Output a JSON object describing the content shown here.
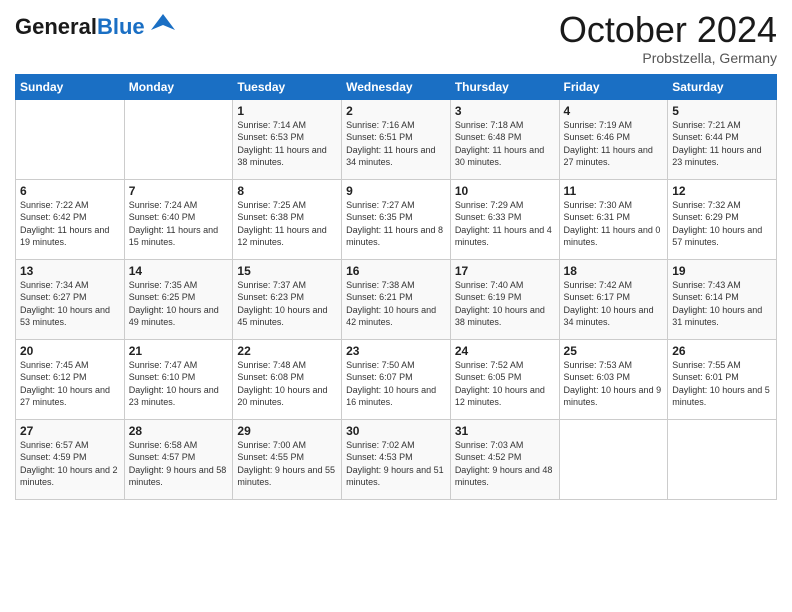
{
  "header": {
    "logo_general": "General",
    "logo_blue": "Blue",
    "month_title": "October 2024",
    "location": "Probstzella, Germany"
  },
  "weekdays": [
    "Sunday",
    "Monday",
    "Tuesday",
    "Wednesday",
    "Thursday",
    "Friday",
    "Saturday"
  ],
  "weeks": [
    [
      null,
      null,
      {
        "day": "1",
        "sunrise": "Sunrise: 7:14 AM",
        "sunset": "Sunset: 6:53 PM",
        "daylight": "Daylight: 11 hours and 38 minutes."
      },
      {
        "day": "2",
        "sunrise": "Sunrise: 7:16 AM",
        "sunset": "Sunset: 6:51 PM",
        "daylight": "Daylight: 11 hours and 34 minutes."
      },
      {
        "day": "3",
        "sunrise": "Sunrise: 7:18 AM",
        "sunset": "Sunset: 6:48 PM",
        "daylight": "Daylight: 11 hours and 30 minutes."
      },
      {
        "day": "4",
        "sunrise": "Sunrise: 7:19 AM",
        "sunset": "Sunset: 6:46 PM",
        "daylight": "Daylight: 11 hours and 27 minutes."
      },
      {
        "day": "5",
        "sunrise": "Sunrise: 7:21 AM",
        "sunset": "Sunset: 6:44 PM",
        "daylight": "Daylight: 11 hours and 23 minutes."
      }
    ],
    [
      {
        "day": "6",
        "sunrise": "Sunrise: 7:22 AM",
        "sunset": "Sunset: 6:42 PM",
        "daylight": "Daylight: 11 hours and 19 minutes."
      },
      {
        "day": "7",
        "sunrise": "Sunrise: 7:24 AM",
        "sunset": "Sunset: 6:40 PM",
        "daylight": "Daylight: 11 hours and 15 minutes."
      },
      {
        "day": "8",
        "sunrise": "Sunrise: 7:25 AM",
        "sunset": "Sunset: 6:38 PM",
        "daylight": "Daylight: 11 hours and 12 minutes."
      },
      {
        "day": "9",
        "sunrise": "Sunrise: 7:27 AM",
        "sunset": "Sunset: 6:35 PM",
        "daylight": "Daylight: 11 hours and 8 minutes."
      },
      {
        "day": "10",
        "sunrise": "Sunrise: 7:29 AM",
        "sunset": "Sunset: 6:33 PM",
        "daylight": "Daylight: 11 hours and 4 minutes."
      },
      {
        "day": "11",
        "sunrise": "Sunrise: 7:30 AM",
        "sunset": "Sunset: 6:31 PM",
        "daylight": "Daylight: 11 hours and 0 minutes."
      },
      {
        "day": "12",
        "sunrise": "Sunrise: 7:32 AM",
        "sunset": "Sunset: 6:29 PM",
        "daylight": "Daylight: 10 hours and 57 minutes."
      }
    ],
    [
      {
        "day": "13",
        "sunrise": "Sunrise: 7:34 AM",
        "sunset": "Sunset: 6:27 PM",
        "daylight": "Daylight: 10 hours and 53 minutes."
      },
      {
        "day": "14",
        "sunrise": "Sunrise: 7:35 AM",
        "sunset": "Sunset: 6:25 PM",
        "daylight": "Daylight: 10 hours and 49 minutes."
      },
      {
        "day": "15",
        "sunrise": "Sunrise: 7:37 AM",
        "sunset": "Sunset: 6:23 PM",
        "daylight": "Daylight: 10 hours and 45 minutes."
      },
      {
        "day": "16",
        "sunrise": "Sunrise: 7:38 AM",
        "sunset": "Sunset: 6:21 PM",
        "daylight": "Daylight: 10 hours and 42 minutes."
      },
      {
        "day": "17",
        "sunrise": "Sunrise: 7:40 AM",
        "sunset": "Sunset: 6:19 PM",
        "daylight": "Daylight: 10 hours and 38 minutes."
      },
      {
        "day": "18",
        "sunrise": "Sunrise: 7:42 AM",
        "sunset": "Sunset: 6:17 PM",
        "daylight": "Daylight: 10 hours and 34 minutes."
      },
      {
        "day": "19",
        "sunrise": "Sunrise: 7:43 AM",
        "sunset": "Sunset: 6:14 PM",
        "daylight": "Daylight: 10 hours and 31 minutes."
      }
    ],
    [
      {
        "day": "20",
        "sunrise": "Sunrise: 7:45 AM",
        "sunset": "Sunset: 6:12 PM",
        "daylight": "Daylight: 10 hours and 27 minutes."
      },
      {
        "day": "21",
        "sunrise": "Sunrise: 7:47 AM",
        "sunset": "Sunset: 6:10 PM",
        "daylight": "Daylight: 10 hours and 23 minutes."
      },
      {
        "day": "22",
        "sunrise": "Sunrise: 7:48 AM",
        "sunset": "Sunset: 6:08 PM",
        "daylight": "Daylight: 10 hours and 20 minutes."
      },
      {
        "day": "23",
        "sunrise": "Sunrise: 7:50 AM",
        "sunset": "Sunset: 6:07 PM",
        "daylight": "Daylight: 10 hours and 16 minutes."
      },
      {
        "day": "24",
        "sunrise": "Sunrise: 7:52 AM",
        "sunset": "Sunset: 6:05 PM",
        "daylight": "Daylight: 10 hours and 12 minutes."
      },
      {
        "day": "25",
        "sunrise": "Sunrise: 7:53 AM",
        "sunset": "Sunset: 6:03 PM",
        "daylight": "Daylight: 10 hours and 9 minutes."
      },
      {
        "day": "26",
        "sunrise": "Sunrise: 7:55 AM",
        "sunset": "Sunset: 6:01 PM",
        "daylight": "Daylight: 10 hours and 5 minutes."
      }
    ],
    [
      {
        "day": "27",
        "sunrise": "Sunrise: 6:57 AM",
        "sunset": "Sunset: 4:59 PM",
        "daylight": "Daylight: 10 hours and 2 minutes."
      },
      {
        "day": "28",
        "sunrise": "Sunrise: 6:58 AM",
        "sunset": "Sunset: 4:57 PM",
        "daylight": "Daylight: 9 hours and 58 minutes."
      },
      {
        "day": "29",
        "sunrise": "Sunrise: 7:00 AM",
        "sunset": "Sunset: 4:55 PM",
        "daylight": "Daylight: 9 hours and 55 minutes."
      },
      {
        "day": "30",
        "sunrise": "Sunrise: 7:02 AM",
        "sunset": "Sunset: 4:53 PM",
        "daylight": "Daylight: 9 hours and 51 minutes."
      },
      {
        "day": "31",
        "sunrise": "Sunrise: 7:03 AM",
        "sunset": "Sunset: 4:52 PM",
        "daylight": "Daylight: 9 hours and 48 minutes."
      },
      null,
      null
    ]
  ]
}
